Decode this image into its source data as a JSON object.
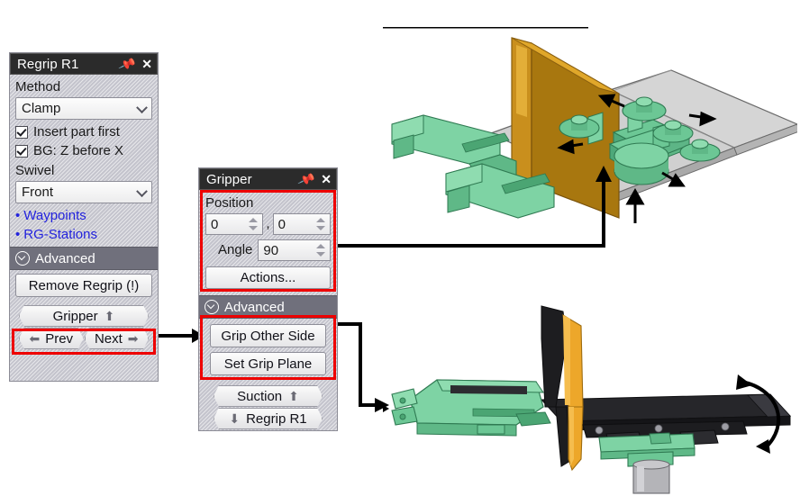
{
  "regrip_panel": {
    "title": "Regrip R1",
    "pin_icon": "pin-icon",
    "close_icon": "close-icon",
    "method_label": "Method",
    "method_value": "Clamp",
    "checkbox_insert": "Insert part first",
    "checkbox_bg": "BG: Z before X",
    "swivel_label": "Swivel",
    "swivel_value": "Front",
    "links": [
      {
        "label": "Waypoints"
      },
      {
        "label": "RG-Stations"
      }
    ],
    "advanced_label": "Advanced",
    "remove_button": "Remove Regrip (!)",
    "gripper_button": "Gripper",
    "gripper_arrow": "⬆",
    "prev_button": "Prev",
    "next_button": "Next",
    "prev_arrow": "⬅",
    "next_arrow": "➡"
  },
  "gripper_panel": {
    "title": "Gripper",
    "pin_icon": "pin-icon",
    "close_icon": "close-icon",
    "position_label": "Position",
    "position_x": "0",
    "position_y": "0",
    "position_separator": ",",
    "angle_label": "Angle",
    "angle_value": "90",
    "actions_button": "Actions...",
    "advanced_label": "Advanced",
    "grip_other_side_button": "Grip Other Side",
    "set_grip_plane_button": "Set Grip Plane",
    "suction_button": "Suction",
    "suction_arrow": "⬆",
    "regrip_button": "Regrip R1",
    "regrip_arrow": "⬇"
  },
  "colors": {
    "highlight": "#ee0000",
    "link": "#2222dd",
    "titlebar": "#2b2b2b",
    "section": "#70707c",
    "panel": "#c8c8d0",
    "part_green": "#72c89a",
    "part_orange": "#d99b23",
    "part_gray": "#c4c4c4",
    "part_black": "#1c1c1c"
  },
  "illustrations": {
    "top": {
      "name": "gripper-suction-assembly-3d-view",
      "description": "Isometric CAD view of gripper with suction cups on sheet metal panel"
    },
    "bottom": {
      "name": "gripper-side-profile-3d-view",
      "description": "Side profile CAD view of gripper arm with rotation arrow"
    }
  }
}
